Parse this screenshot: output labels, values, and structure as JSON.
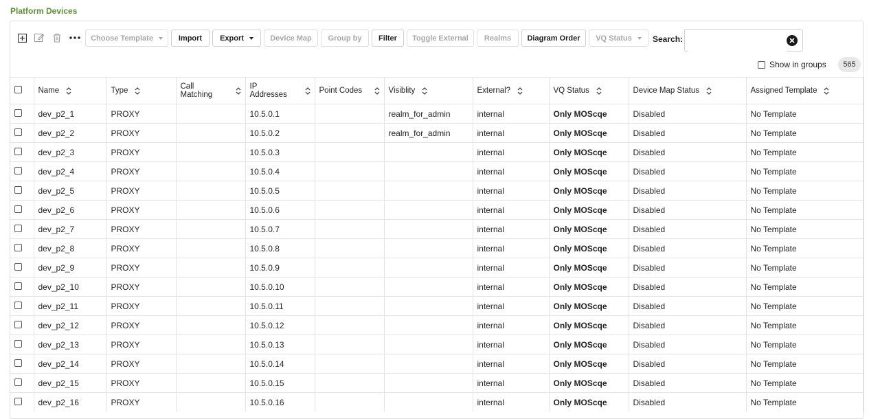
{
  "page": {
    "title": "Platform Devices"
  },
  "toolbar": {
    "buttons": [
      {
        "label": "Choose Template",
        "disabled": true
      },
      {
        "label": "Import",
        "disabled": false
      },
      {
        "label": "Export",
        "disabled": false
      },
      {
        "label": "Device Map",
        "disabled": true
      },
      {
        "label": "Group by",
        "disabled": true
      },
      {
        "label": "Filter",
        "disabled": false
      },
      {
        "label": "Toggle External",
        "disabled": true
      },
      {
        "label": "Realms",
        "disabled": true
      },
      {
        "label": "Diagram Order",
        "disabled": false
      },
      {
        "label": "VQ Status",
        "disabled": true
      }
    ],
    "icons": [
      "add-icon",
      "edit-icon",
      "trash-icon",
      "more-icon"
    ]
  },
  "search": {
    "label": "Search:",
    "value": "",
    "placeholder": ""
  },
  "groups": {
    "label": "Show in groups",
    "checked": false
  },
  "count": "565",
  "table": {
    "columns": [
      {
        "label": "Name"
      },
      {
        "label": "Type"
      },
      {
        "label": "Call Matching"
      },
      {
        "label": "IP Addresses"
      },
      {
        "label": "Point Codes"
      },
      {
        "label": "Visiblity"
      },
      {
        "label": "External?"
      },
      {
        "label": "VQ Status"
      },
      {
        "label": "Device Map Status"
      },
      {
        "label": "Assigned Template"
      }
    ],
    "rows": [
      {
        "name": "dev_p2_1",
        "type": "PROXY",
        "call": "",
        "ip": "10.5.0.1",
        "pc": "",
        "vis": "realm_for_admin",
        "ext": "internal",
        "vq": "Only MOScqe",
        "dm": "Disabled",
        "tpl": "No Template"
      },
      {
        "name": "dev_p2_2",
        "type": "PROXY",
        "call": "",
        "ip": "10.5.0.2",
        "pc": "",
        "vis": "realm_for_admin",
        "ext": "internal",
        "vq": "Only MOScqe",
        "dm": "Disabled",
        "tpl": "No Template"
      },
      {
        "name": "dev_p2_3",
        "type": "PROXY",
        "call": "",
        "ip": "10.5.0.3",
        "pc": "",
        "vis": "",
        "ext": "internal",
        "vq": "Only MOScqe",
        "dm": "Disabled",
        "tpl": "No Template"
      },
      {
        "name": "dev_p2_4",
        "type": "PROXY",
        "call": "",
        "ip": "10.5.0.4",
        "pc": "",
        "vis": "",
        "ext": "internal",
        "vq": "Only MOScqe",
        "dm": "Disabled",
        "tpl": "No Template"
      },
      {
        "name": "dev_p2_5",
        "type": "PROXY",
        "call": "",
        "ip": "10.5.0.5",
        "pc": "",
        "vis": "",
        "ext": "internal",
        "vq": "Only MOScqe",
        "dm": "Disabled",
        "tpl": "No Template"
      },
      {
        "name": "dev_p2_6",
        "type": "PROXY",
        "call": "",
        "ip": "10.5.0.6",
        "pc": "",
        "vis": "",
        "ext": "internal",
        "vq": "Only MOScqe",
        "dm": "Disabled",
        "tpl": "No Template"
      },
      {
        "name": "dev_p2_7",
        "type": "PROXY",
        "call": "",
        "ip": "10.5.0.7",
        "pc": "",
        "vis": "",
        "ext": "internal",
        "vq": "Only MOScqe",
        "dm": "Disabled",
        "tpl": "No Template"
      },
      {
        "name": "dev_p2_8",
        "type": "PROXY",
        "call": "",
        "ip": "10.5.0.8",
        "pc": "",
        "vis": "",
        "ext": "internal",
        "vq": "Only MOScqe",
        "dm": "Disabled",
        "tpl": "No Template"
      },
      {
        "name": "dev_p2_9",
        "type": "PROXY",
        "call": "",
        "ip": "10.5.0.9",
        "pc": "",
        "vis": "",
        "ext": "internal",
        "vq": "Only MOScqe",
        "dm": "Disabled",
        "tpl": "No Template"
      },
      {
        "name": "dev_p2_10",
        "type": "PROXY",
        "call": "",
        "ip": "10.5.0.10",
        "pc": "",
        "vis": "",
        "ext": "internal",
        "vq": "Only MOScqe",
        "dm": "Disabled",
        "tpl": "No Template"
      },
      {
        "name": "dev_p2_11",
        "type": "PROXY",
        "call": "",
        "ip": "10.5.0.11",
        "pc": "",
        "vis": "",
        "ext": "internal",
        "vq": "Only MOScqe",
        "dm": "Disabled",
        "tpl": "No Template"
      },
      {
        "name": "dev_p2_12",
        "type": "PROXY",
        "call": "",
        "ip": "10.5.0.12",
        "pc": "",
        "vis": "",
        "ext": "internal",
        "vq": "Only MOScqe",
        "dm": "Disabled",
        "tpl": "No Template"
      },
      {
        "name": "dev_p2_13",
        "type": "PROXY",
        "call": "",
        "ip": "10.5.0.13",
        "pc": "",
        "vis": "",
        "ext": "internal",
        "vq": "Only MOScqe",
        "dm": "Disabled",
        "tpl": "No Template"
      },
      {
        "name": "dev_p2_14",
        "type": "PROXY",
        "call": "",
        "ip": "10.5.0.14",
        "pc": "",
        "vis": "",
        "ext": "internal",
        "vq": "Only MOScqe",
        "dm": "Disabled",
        "tpl": "No Template"
      },
      {
        "name": "dev_p2_15",
        "type": "PROXY",
        "call": "",
        "ip": "10.5.0.15",
        "pc": "",
        "vis": "",
        "ext": "internal",
        "vq": "Only MOScqe",
        "dm": "Disabled",
        "tpl": "No Template"
      },
      {
        "name": "dev_p2_16",
        "type": "PROXY",
        "call": "",
        "ip": "10.5.0.16",
        "pc": "",
        "vis": "",
        "ext": "internal",
        "vq": "Only MOScqe",
        "dm": "Disabled",
        "tpl": "No Template"
      }
    ]
  },
  "colors": {
    "title": "#5a8a3a",
    "border": "#e3e3e3",
    "disabled_text": "#a8a8a8"
  }
}
